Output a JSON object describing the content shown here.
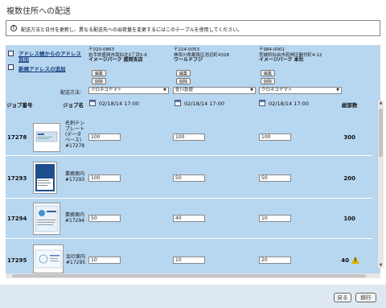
{
  "page": {
    "title": "複数住所への配送"
  },
  "info": {
    "text": "配送方法と日付を更新し、異なる配送先への出荷量を変更するにはこのテーブルを使用してください。"
  },
  "links": {
    "add_from_book_1": "アドレス帳からのアドレス",
    "add_from_book_2": "追加",
    "add_new": "新規アドレスの追加"
  },
  "addresses": [
    {
      "zip": "〒020-0863",
      "street": "岩手県盛岡市南仙北3丁目5-6",
      "name": "イメージパーク 盛岡支店",
      "edit": "編集",
      "delete": "削除"
    },
    {
      "zip": "〒224-0053",
      "street": "神奈川県都筑区池辺町4328",
      "name": "ワールドフジ",
      "edit": "編集",
      "delete": "削除"
    },
    {
      "zip": "〒984-0001",
      "street": "宮城県仙台市若林区鶴代町4-12",
      "name": "イメージパーク 本社",
      "edit": "編集",
      "delete": "削除"
    }
  ],
  "shipping": {
    "label": "配送方法:",
    "methods": [
      "クロネコヤマト",
      "佐川急便",
      "クロネコヤマト"
    ]
  },
  "headers": {
    "job_number": "ジョブ番号",
    "job_name": "ジョブ名",
    "total": "総部数"
  },
  "dates": [
    "02/18/14 17:00",
    "02/18/14 17:00",
    "02/18/14 17:00"
  ],
  "jobs": [
    {
      "number": "17278",
      "name_lines": [
        "名刺テン",
        "プレート",
        "(データ",
        "ベース)",
        "#17278"
      ],
      "quantities": [
        "100",
        "100",
        "100"
      ],
      "total": "300",
      "warning": false
    },
    {
      "number": "17293",
      "name_lines": [
        "業務案内",
        "#17293"
      ],
      "quantities": [
        "100",
        "50",
        "50"
      ],
      "total": "200",
      "warning": false
    },
    {
      "number": "17294",
      "name_lines": [
        "業務案内",
        "#17294"
      ],
      "quantities": [
        "50",
        "40",
        "10"
      ],
      "total": "100",
      "warning": false
    },
    {
      "number": "17295",
      "name_lines": [
        "会社案内",
        "#17295"
      ],
      "quantities": [
        "10",
        "10",
        "20"
      ],
      "total": "40",
      "warning": true
    }
  ],
  "footer": {
    "back": "戻る",
    "continue": "続行"
  },
  "colors": {
    "panel": "#b7d6f0",
    "link": "#123b7c",
    "warning": "#e0b000"
  }
}
